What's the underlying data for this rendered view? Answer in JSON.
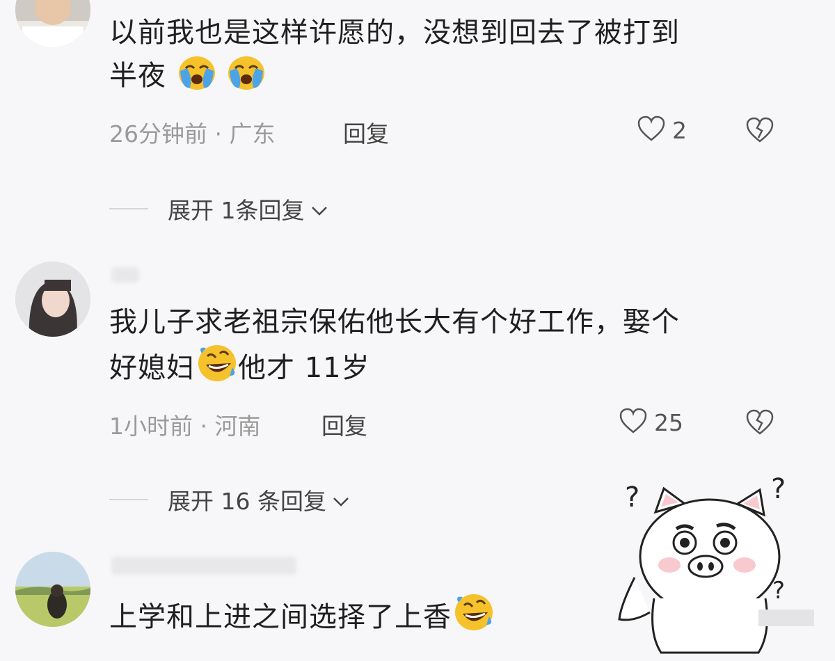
{
  "comments": [
    {
      "text_line1": "以前我也是这样许愿的，没想到回去了被打到",
      "text_line2": "半夜",
      "emoji": "loudly-crying-face",
      "time": "26分钟前 · 广东",
      "reply": "回复",
      "likes": "2",
      "expand": "展开 1条回复"
    },
    {
      "text_line1": "我儿子求老祖宗保佑他长大有个好工作，娶个",
      "text_line2a": "好媳妇",
      "text_line2b": "他才 11岁",
      "emoji": "rolling-on-floor-laughing",
      "time": "1小时前 · 河南",
      "reply": "回复",
      "likes": "25",
      "expand": "展开 16 条回复"
    },
    {
      "text_line1": "上学和上进之间选择了上香",
      "emoji": "rolling-on-floor-laughing"
    }
  ],
  "sticker": {
    "name": "confused-pig-sticker",
    "marks": [
      "?",
      "?",
      "?"
    ]
  },
  "colors": {
    "background": "#f7f7f9",
    "text": "#1f1f1f",
    "meta": "#9a9a9a",
    "emoji_face": "#f5c22b",
    "tear_blue": "#4da3e8",
    "pig_pink": "#f8c9cf"
  }
}
